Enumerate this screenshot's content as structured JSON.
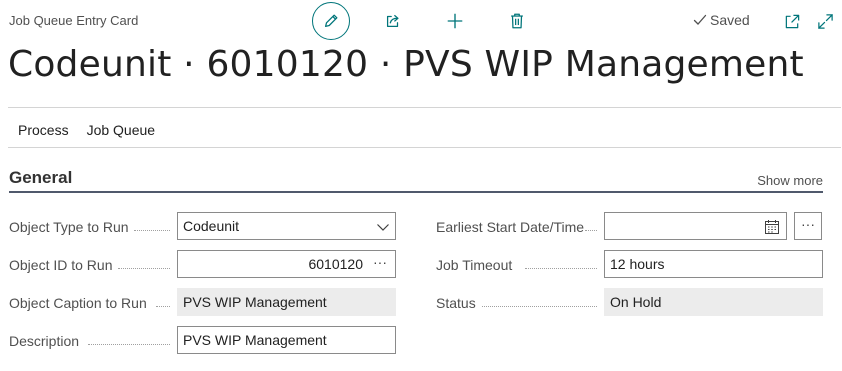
{
  "header": {
    "page_caption": "Job Queue Entry Card",
    "saved_label": "Saved",
    "record_title": "Codeunit · 6010120 · PVS WIP Management"
  },
  "menu": {
    "items": [
      {
        "label": "Process"
      },
      {
        "label": "Job Queue"
      }
    ]
  },
  "section": {
    "title": "General",
    "show_more": "Show more"
  },
  "fields": {
    "object_type_to_run": {
      "label": "Object Type to Run",
      "value": "Codeunit"
    },
    "object_id_to_run": {
      "label": "Object ID to Run",
      "value": "6010120"
    },
    "object_caption_to_run": {
      "label": "Object Caption to Run",
      "value": "PVS WIP Management"
    },
    "description": {
      "label": "Description",
      "value": "PVS WIP Management"
    },
    "earliest_start": {
      "label": "Earliest Start Date/Time",
      "value": ""
    },
    "job_timeout": {
      "label": "Job Timeout",
      "value": "12 hours"
    },
    "status": {
      "label": "Status",
      "value": "On Hold"
    }
  },
  "glyphs": {
    "ellipsis": "···"
  },
  "colors": {
    "accent": "#00757a",
    "section_underline": "#50596c",
    "readonly_bg": "#ececec"
  },
  "icons": [
    "edit-icon",
    "share-icon",
    "add-icon",
    "delete-icon",
    "checkmark-icon",
    "popout-icon",
    "expand-icon",
    "chevron-down-icon",
    "calendar-icon"
  ]
}
